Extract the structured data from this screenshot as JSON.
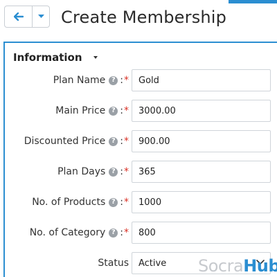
{
  "header": {
    "title": "Create Membership",
    "accent_color": "#2b8ed1",
    "back_icon": "arrow-left-icon",
    "menu_icon": "caret-down-icon"
  },
  "section": {
    "title": "Information",
    "collapse_icon": "caret-down-icon"
  },
  "form": {
    "help_glyph": "?",
    "colon": ":",
    "required_mark": "*",
    "fields": [
      {
        "label": "Plan Name",
        "value": "Gold"
      },
      {
        "label": "Main Price",
        "value": "3000.00"
      },
      {
        "label": "Discounted Price",
        "value": "900.00"
      },
      {
        "label": "Plan Days",
        "value": "365"
      },
      {
        "label": "No. of Products",
        "value": "1000"
      },
      {
        "label": "No. of Category",
        "value": "800"
      }
    ],
    "status": {
      "label": "Status",
      "value": "Active",
      "icon": "chevron-down-icon"
    }
  },
  "watermark": {
    "part1": "Socra",
    "part2": "Hub"
  }
}
